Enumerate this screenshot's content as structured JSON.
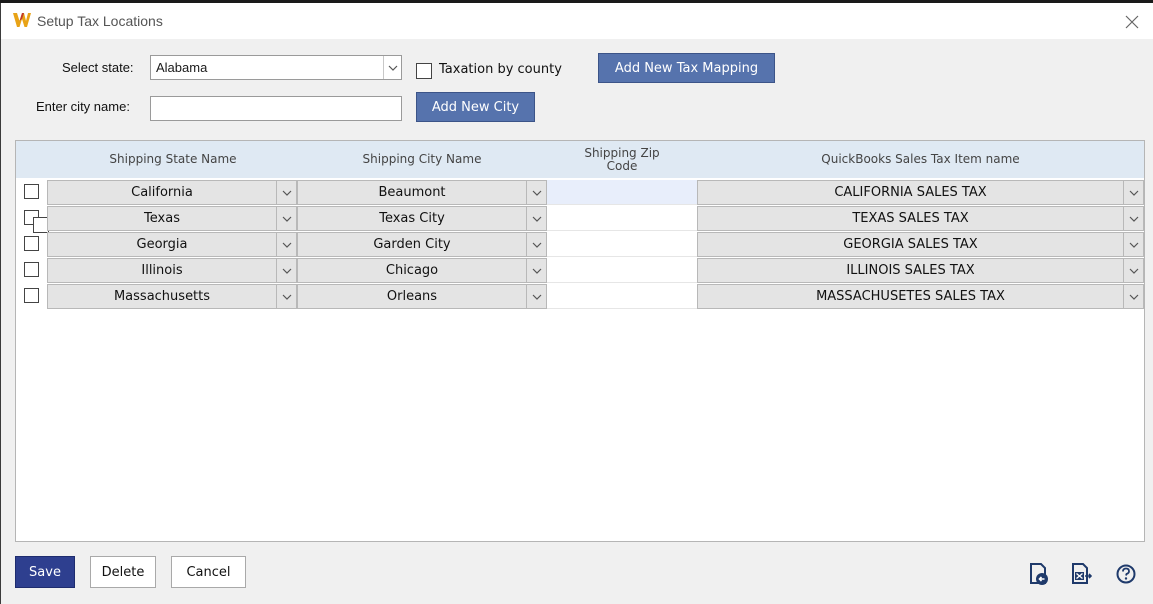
{
  "window": {
    "title": "Setup Tax Locations",
    "app_icon": "w-logo-icon",
    "close_icon": "close-icon"
  },
  "form": {
    "state_label": "Select state:",
    "state_value": "Alabama",
    "county_label": "Taxation by county",
    "county_checked": false,
    "add_mapping_label": "Add New Tax Mapping",
    "city_label": "Enter city name:",
    "city_value": "",
    "add_city_label": "Add New City"
  },
  "grid": {
    "headers": {
      "state": "Shipping State Name",
      "city": "Shipping City Name",
      "zip_line1": "Shipping Zip",
      "zip_line2": "Code",
      "tax": "QuickBooks Sales Tax Item name"
    },
    "rows": [
      {
        "state": "California",
        "city": "Beaumont",
        "zip": "",
        "tax": "CALIFORNIA SALES TAX"
      },
      {
        "state": "Texas",
        "city": "Texas City",
        "zip": "",
        "tax": "TEXAS SALES TAX"
      },
      {
        "state": "Georgia",
        "city": "Garden City",
        "zip": "",
        "tax": "GEORGIA SALES TAX"
      },
      {
        "state": "Illinois",
        "city": "Chicago",
        "zip": "",
        "tax": "ILLINOIS SALES TAX"
      },
      {
        "state": "Massachusetts",
        "city": "Orleans",
        "zip": "",
        "tax": "MASSACHUSETES SALES TAX"
      }
    ]
  },
  "footer": {
    "save_label": "Save",
    "delete_label": "Delete",
    "cancel_label": "Cancel",
    "icons": [
      "import-icon",
      "export-excel-icon",
      "help-icon"
    ]
  },
  "colors": {
    "accent": "#5673ad",
    "save": "#2e3f8f",
    "header_bg": "#dfe9f3",
    "logo": "#e8a317"
  }
}
